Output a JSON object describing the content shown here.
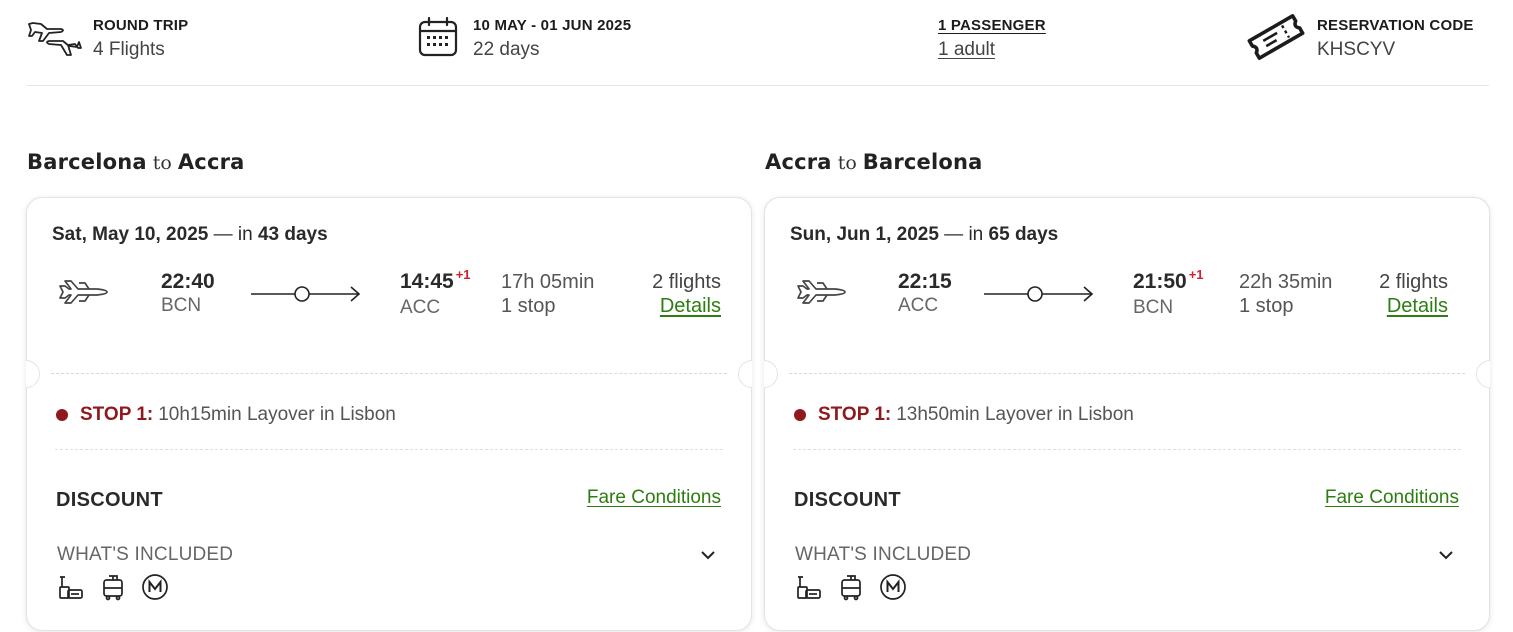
{
  "summary": {
    "trip": {
      "heading": "ROUND TRIP",
      "sub": "4 Flights",
      "icon": "round-trip-planes-icon"
    },
    "dates": {
      "heading": "10 MAY - 01 JUN 2025",
      "sub": "22 days",
      "icon": "calendar-icon"
    },
    "passengers": {
      "heading": "1 PASSENGER",
      "sub": "1 adult"
    },
    "reservation": {
      "heading": "RESERVATION CODE",
      "sub": "KHSCYV",
      "icon": "ticket-icon"
    }
  },
  "outbound": {
    "title": {
      "from": "Barcelona",
      "to_word": "to",
      "to": "Accra"
    },
    "date": "Sat, May 10, 2025",
    "in_prefix": " — in ",
    "in_days": "43 days",
    "dep_time": "22:40",
    "dep_code": "BCN",
    "arr_time": "14:45",
    "arr_plus": "+1",
    "arr_code": "ACC",
    "duration": "17h 05min",
    "stops": "1 stop",
    "flights": "2 flights",
    "details": "Details",
    "stop_label": "STOP 1:",
    "stop_text": "10h15min Layover in Lisbon",
    "fare_name": "DISCOUNT",
    "fare_conditions": "Fare Conditions",
    "included": "WHAT'S INCLUDED"
  },
  "inbound": {
    "title": {
      "from": "Accra",
      "to_word": "to",
      "to": "Barcelona"
    },
    "date": "Sun, Jun 1, 2025",
    "in_prefix": " — in ",
    "in_days": "65 days",
    "dep_time": "22:15",
    "dep_code": "ACC",
    "arr_time": "21:50",
    "arr_plus": "+1",
    "arr_code": "BCN",
    "duration": "22h 35min",
    "stops": "1 stop",
    "flights": "2 flights",
    "details": "Details",
    "stop_label": "STOP 1:",
    "stop_text": "13h50min Layover in Lisbon",
    "fare_name": "DISCOUNT",
    "fare_conditions": "Fare Conditions",
    "included": "WHAT'S INCLUDED"
  },
  "colors": {
    "accent_red": "#8e1a1e",
    "plus_red": "#d4202a",
    "link_green": "#2e7d12"
  },
  "amenities": [
    "hand-luggage-icon",
    "checked-bag-icon",
    "miles-m-icon"
  ]
}
